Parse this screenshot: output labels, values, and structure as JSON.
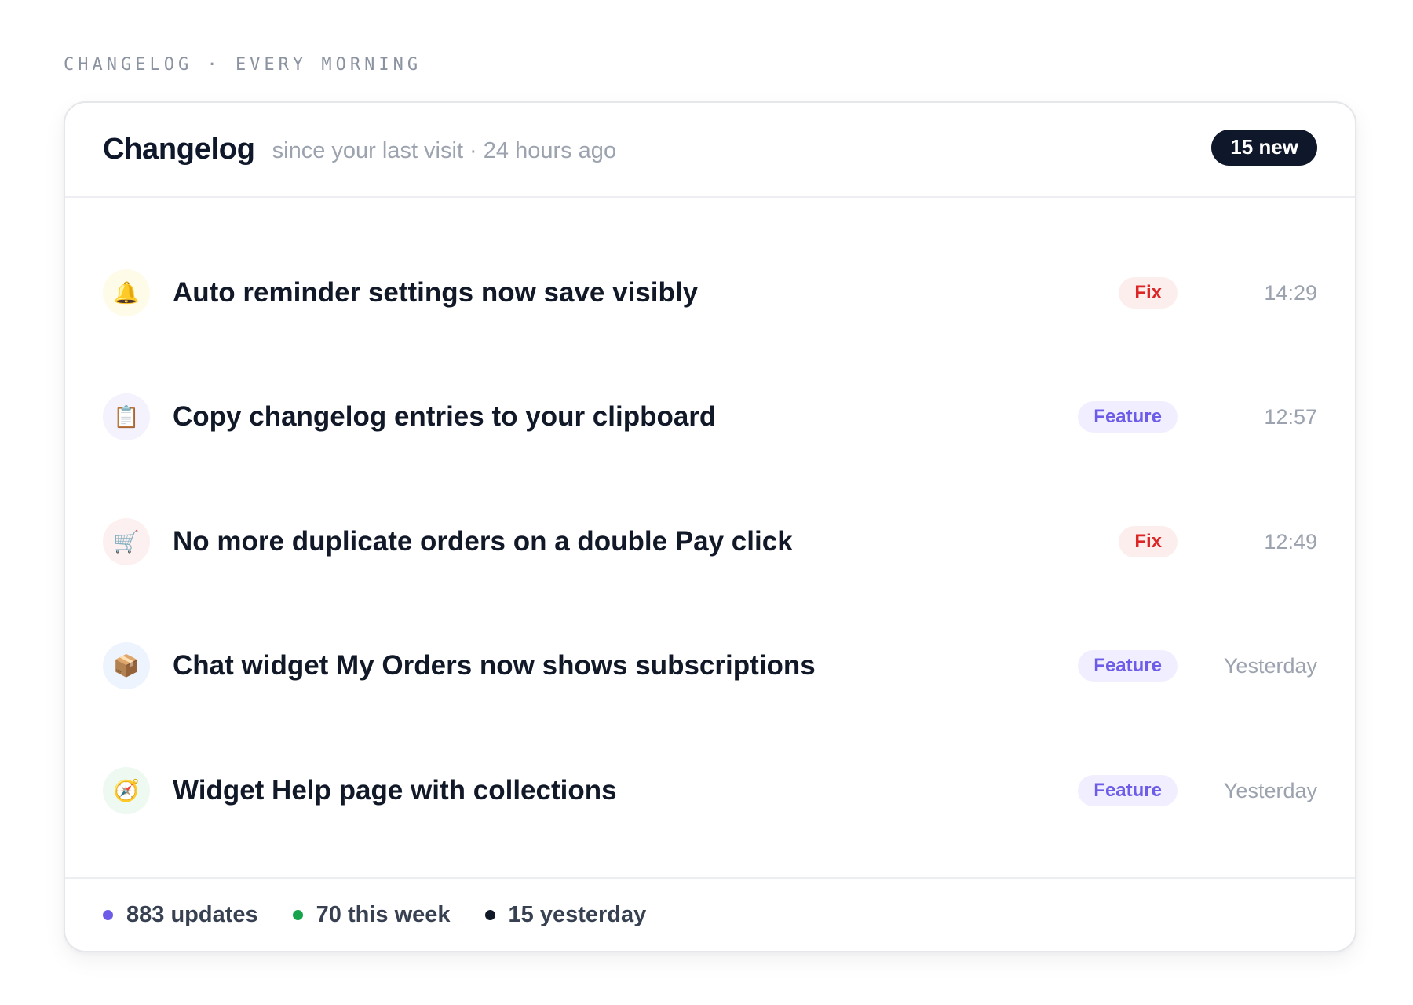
{
  "eyebrow": "CHANGELOG · EVERY MORNING",
  "header": {
    "title": "Changelog",
    "subtitle": "since your last visit · 24 hours ago",
    "badge": "15 new"
  },
  "entries": [
    {
      "icon": "bell-icon",
      "glyph": "🔔",
      "icon_bg": "#fefbe8",
      "title": "Auto reminder settings now save visibly",
      "tag": "Fix",
      "tag_kind": "fix",
      "time": "14:29"
    },
    {
      "icon": "clipboard-icon",
      "glyph": "📋",
      "icon_bg": "#f3f2fd",
      "title": "Copy changelog entries to your clipboard",
      "tag": "Feature",
      "tag_kind": "feature",
      "time": "12:57"
    },
    {
      "icon": "shopping-cart-icon",
      "glyph": "🛒",
      "icon_bg": "#fdf0f0",
      "title": "No more duplicate orders on a double Pay click",
      "tag": "Fix",
      "tag_kind": "fix",
      "time": "12:49"
    },
    {
      "icon": "package-icon",
      "glyph": "📦",
      "icon_bg": "#eef4fd",
      "title": "Chat widget My Orders now shows subscriptions",
      "tag": "Feature",
      "tag_kind": "feature",
      "time": "Yesterday"
    },
    {
      "icon": "compass-icon",
      "glyph": "🧭",
      "icon_bg": "#edf9f1",
      "title": "Widget Help page with collections",
      "tag": "Feature",
      "tag_kind": "feature",
      "time": "Yesterday"
    }
  ],
  "footer": {
    "stats": [
      {
        "label": "883 updates",
        "color": "#6d5ce8"
      },
      {
        "label": "70 this week",
        "color": "#16a34a"
      },
      {
        "label": "15 yesterday",
        "color": "#111827"
      }
    ]
  }
}
